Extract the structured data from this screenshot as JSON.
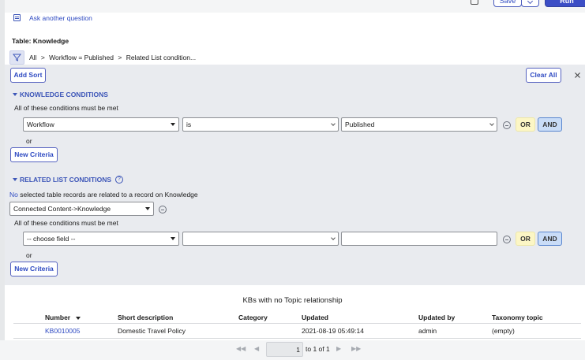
{
  "toolbar": {
    "save_label": "Save",
    "run_label": "Run"
  },
  "ask": {
    "label": "Ask another question"
  },
  "table": {
    "label": "Table: Knowledge"
  },
  "breadcrumb": {
    "all": "All",
    "sep1": ">",
    "crumb1": "Workflow = Published",
    "sep2": ">",
    "crumb2": "Related List condition..."
  },
  "actions": {
    "add_sort": "Add Sort",
    "clear_all": "Clear All"
  },
  "knowledge": {
    "title": "KNOWLEDGE CONDITIONS",
    "rule": "All of these conditions must be met",
    "field": "Workflow",
    "operator": "is",
    "value": "Published",
    "or_label": "OR",
    "and_label": "AND",
    "or_sep": "or",
    "new_criteria": "New Criteria"
  },
  "related": {
    "title": "RELATED LIST CONDITIONS",
    "no_link": "No",
    "desc": "selected table records are related to a record on Knowledge",
    "relation": "Connected Content->Knowledge",
    "rule": "All of these conditions must be met",
    "field": "-- choose field --",
    "operator": "",
    "value": "",
    "or_label": "OR",
    "and_label": "AND",
    "or_sep": "or",
    "new_criteria": "New Criteria"
  },
  "results": {
    "title": "KBs with no Topic relationship",
    "columns": [
      "Number",
      "Short description",
      "Category",
      "Updated",
      "Updated by",
      "Taxonomy topic"
    ],
    "rows": [
      {
        "number": "KB0010005",
        "short_description": "Domestic Travel Policy",
        "category": "",
        "updated": "2021-08-19 05:49:14",
        "updated_by": "admin",
        "taxonomy_topic": "(empty)"
      }
    ]
  },
  "pagination": {
    "current": "1",
    "range_text": "to 1 of 1"
  },
  "icons": [
    "ask-icon",
    "filter-icon",
    "close-icon",
    "help-icon",
    "remove-condition-icon",
    "sort-desc-icon",
    "first-page-icon",
    "prev-page-icon",
    "next-page-icon",
    "last-page-icon",
    "overflow-icon"
  ]
}
